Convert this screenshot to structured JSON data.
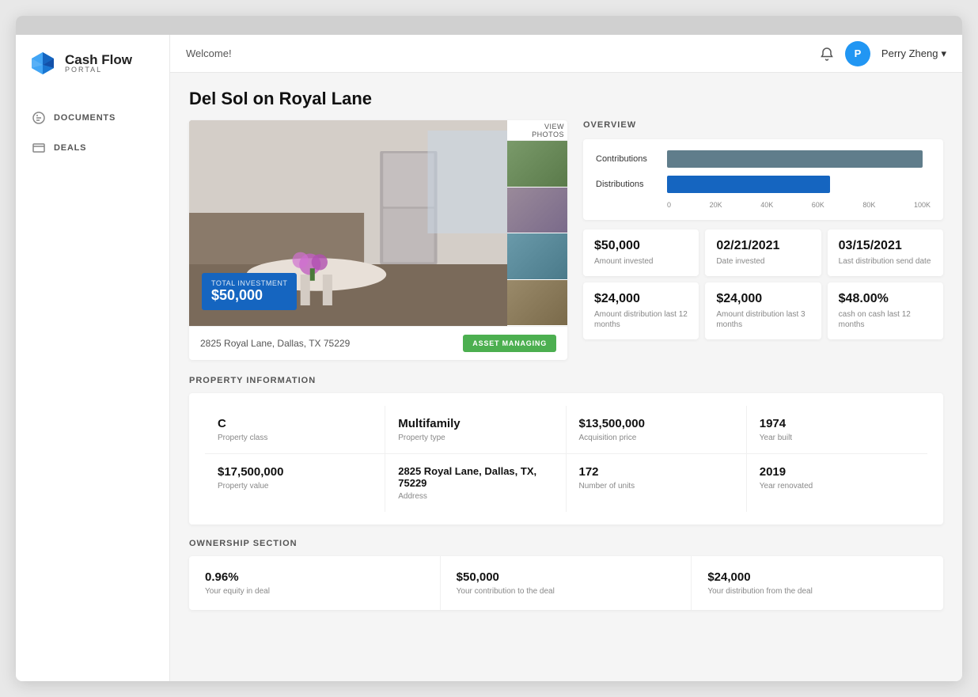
{
  "app": {
    "name": "Cash Flow",
    "subtitle": "PORTAL",
    "topbar_bg": "#d0d0d0"
  },
  "header": {
    "welcome": "Welcome!",
    "user_initial": "P",
    "user_name": "Perry Zheng",
    "user_chevron": "▾"
  },
  "sidebar": {
    "items": [
      {
        "id": "documents",
        "label": "DOCUMENTS",
        "icon": "doc"
      },
      {
        "id": "deals",
        "label": "DEALS",
        "icon": "tag"
      }
    ]
  },
  "page": {
    "title": "Del Sol on Royal Lane"
  },
  "property": {
    "address": "2825 Royal Lane, Dallas, TX 75229",
    "asset_button": "ASSET MANAGING",
    "view_photos": "VIEW  PHOTOS",
    "investment_label": "Total investment",
    "investment_amount": "$50,000"
  },
  "overview": {
    "title": "OVERVIEW",
    "chart": {
      "contributions_label": "Contributions",
      "distributions_label": "Distributions",
      "contributions_pct": 97,
      "distributions_pct": 62,
      "axis": [
        "0",
        "20K",
        "40K",
        "60K",
        "80K",
        "100K"
      ]
    },
    "stats": [
      {
        "value": "$50,000",
        "label": "Amount invested"
      },
      {
        "value": "02/21/2021",
        "label": "Date invested"
      },
      {
        "value": "03/15/2021",
        "label": "Last distribution send date"
      },
      {
        "value": "$24,000",
        "label": "Amount distribution last 12 months"
      },
      {
        "value": "$24,000",
        "label": "Amount distribution last 3 months"
      },
      {
        "value": "$48.00%",
        "label": "cash on cash last 12 months"
      }
    ]
  },
  "property_info": {
    "title": "PROPERTY INFORMATION",
    "fields": [
      {
        "value": "C",
        "label": "Property class"
      },
      {
        "value": "Multifamily",
        "label": "Property type"
      },
      {
        "value": "$13,500,000",
        "label": "Acquisition price"
      },
      {
        "value": "1974",
        "label": "Year built"
      },
      {
        "value": "$17,500,000",
        "label": "Property value"
      },
      {
        "value": "2825 Royal Lane, Dallas, TX, 75229",
        "label": "Address"
      },
      {
        "value": "172",
        "label": "Number of units"
      },
      {
        "value": "2019",
        "label": "Year renovated"
      }
    ]
  },
  "ownership": {
    "title": "OWNERSHIP SECTION",
    "fields": [
      {
        "value": "0.96%",
        "label": "Your equity in deal"
      },
      {
        "value": "$50,000",
        "label": "Your contribution to the deal"
      },
      {
        "value": "$24,000",
        "label": "Your distribution from the deal"
      }
    ]
  }
}
